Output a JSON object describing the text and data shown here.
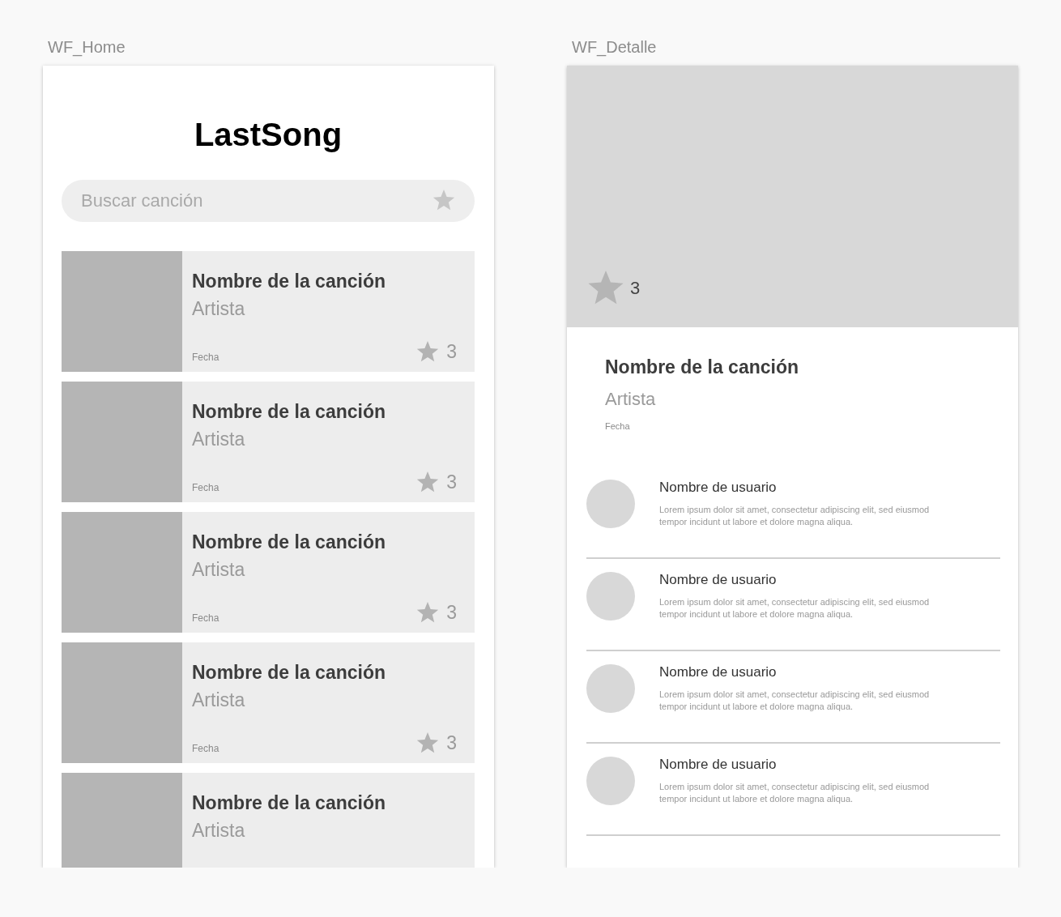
{
  "home": {
    "label": "WF_Home",
    "title": "LastSong",
    "search": {
      "placeholder": "Buscar canción"
    },
    "songs": [
      {
        "title": "Nombre de la canción",
        "artist": "Artista",
        "date": "Fecha",
        "rating": "3"
      },
      {
        "title": "Nombre de la canción",
        "artist": "Artista",
        "date": "Fecha",
        "rating": "3"
      },
      {
        "title": "Nombre de la canción",
        "artist": "Artista",
        "date": "Fecha",
        "rating": "3"
      },
      {
        "title": "Nombre de la canción",
        "artist": "Artista",
        "date": "Fecha",
        "rating": "3"
      },
      {
        "title": "Nombre de la canción",
        "artist": "Artista"
      }
    ]
  },
  "detail": {
    "label": "WF_Detalle",
    "rating": "3",
    "title": "Nombre de la canción",
    "artist": "Artista",
    "date": "Fecha",
    "comments": [
      {
        "user": "Nombre de usuario",
        "text": "Lorem ipsum dolor sit amet, consectetur adipiscing elit, sed eiusmod tempor incidunt ut labore et dolore magna aliqua."
      },
      {
        "user": "Nombre de usuario",
        "text": "Lorem ipsum dolor sit amet, consectetur adipiscing elit, sed eiusmod tempor incidunt ut labore et dolore magna aliqua."
      },
      {
        "user": "Nombre de usuario",
        "text": "Lorem ipsum dolor sit amet, consectetur adipiscing elit, sed eiusmod tempor incidunt ut labore et dolore magna aliqua."
      },
      {
        "user": "Nombre de usuario",
        "text": "Lorem ipsum dolor sit amet, consectetur adipiscing elit, sed eiusmod tempor incidunt ut labore et dolore magna aliqua."
      }
    ]
  }
}
